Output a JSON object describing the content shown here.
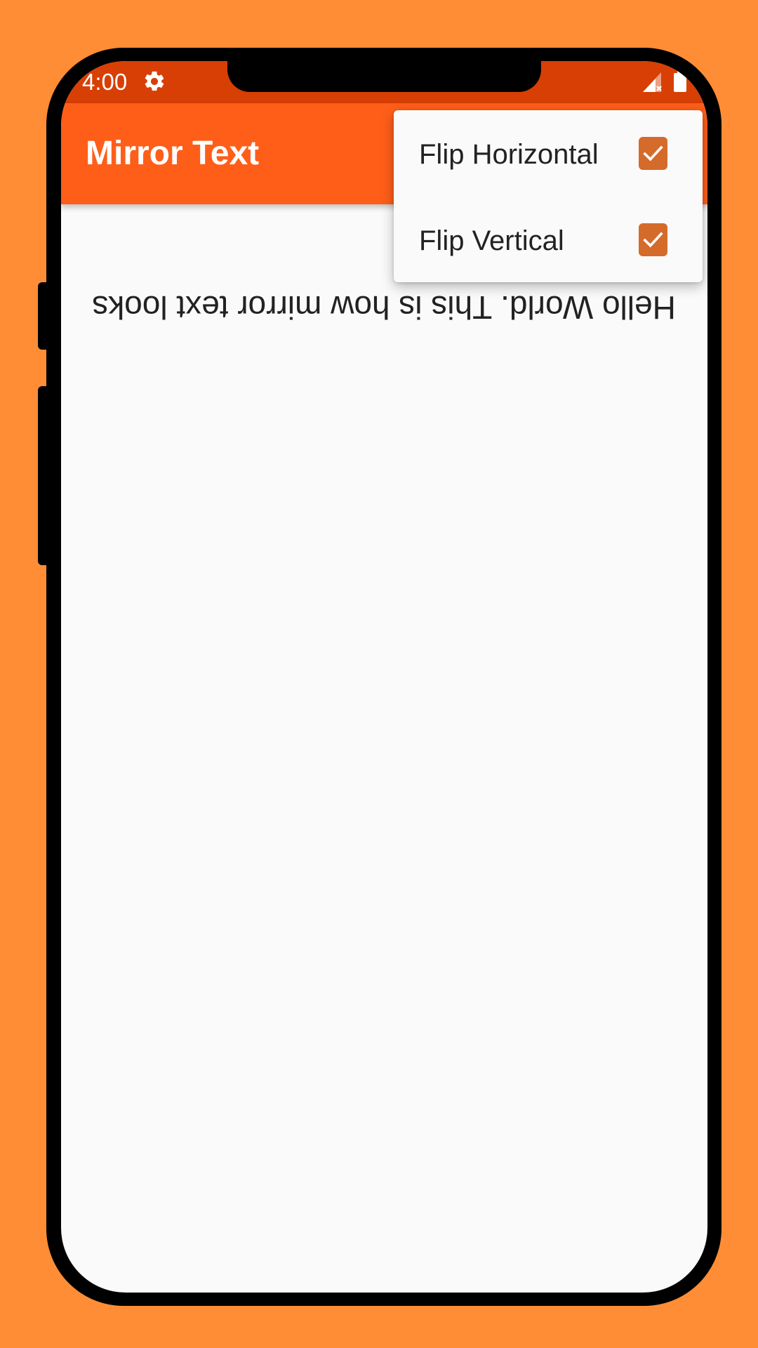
{
  "status_bar": {
    "time": "4:00",
    "icons": [
      "gear-icon",
      "signal-icon",
      "battery-icon"
    ]
  },
  "app_bar": {
    "title": "Mirror Text"
  },
  "content": {
    "mirrored_text": "Hello World. This is how mirror text looks",
    "flip_horizontal": true,
    "flip_vertical": true
  },
  "menu": {
    "items": [
      {
        "label": "Flip Horizontal",
        "checked": true
      },
      {
        "label": "Flip Vertical",
        "checked": true
      }
    ]
  },
  "colors": {
    "background": "#FF8D35",
    "status_bar": "#D83F05",
    "app_bar": "#FF5E19",
    "checkbox": "#D46B2A",
    "screen": "#FAFAFA"
  }
}
